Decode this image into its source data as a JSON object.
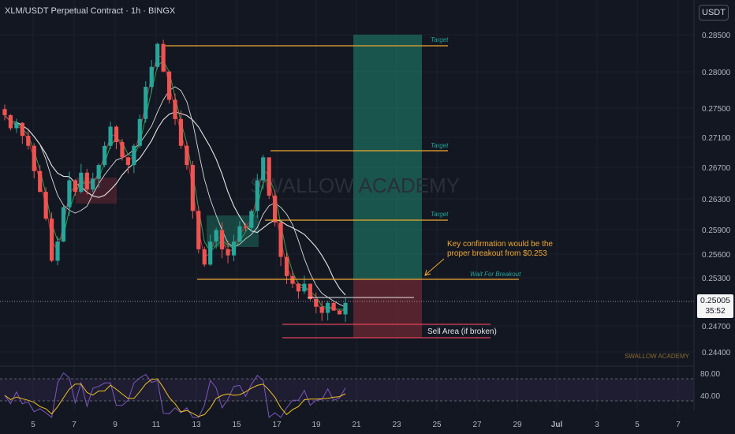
{
  "header": {
    "title": "XLM/USDT Perpetual Contract · 1h · BINGX",
    "currency_button": "USDT"
  },
  "watermark": "SWALLOW ACADEMY",
  "watermark_small": "SWALLOW ACADEMY",
  "last_price": {
    "value": "0.25005",
    "countdown": "35:52"
  },
  "colors": {
    "background": "#131722",
    "up": "#26a69a",
    "down": "#ef5350",
    "level_line": "#f0a830",
    "target_zone": "#1e7f6b",
    "stop_zone": "#7a2a36",
    "sell_line": "#e0435a",
    "rsi_line": "#7e57c2",
    "rsi_signal": "#f0c020"
  },
  "annotations": {
    "target_1": "Target",
    "target_2": "Target",
    "target_3": "Target",
    "wait": "Wait For Breakout",
    "note_line1": "Key confirmation would be the",
    "note_line2": "proper breakout from $0.253",
    "sell": "Sell Area (if broken)"
  },
  "chart_data": {
    "type": "candlestick",
    "y_ticks": [
      "0.28500",
      "0.28000",
      "0.27500",
      "0.27100",
      "0.26700",
      "0.26300",
      "0.25900",
      "0.25600",
      "0.25300",
      "0.24700",
      "0.24400"
    ],
    "x_ticks": [
      "5",
      "7",
      "9",
      "11",
      "13",
      "15",
      "17",
      "19",
      "21",
      "23",
      "25",
      "27",
      "29",
      "Jul",
      "3",
      "5",
      "7"
    ],
    "ylim": [
      0.2425,
      0.2872
    ],
    "levels": [
      {
        "name": "Target",
        "price": 0.284
      },
      {
        "name": "Target",
        "price": 0.269
      },
      {
        "name": "Target",
        "price": 0.2601
      },
      {
        "name": "Wait For Breakout",
        "price": 0.2529
      },
      {
        "name": "Sell Area (if broken)",
        "price": 0.2472
      }
    ],
    "closes": [
      0.2745,
      0.2728,
      0.2735,
      0.2718,
      0.2705,
      0.2672,
      0.2645,
      0.261,
      0.2555,
      0.258,
      0.2625,
      0.266,
      0.2645,
      0.267,
      0.2648,
      0.2662,
      0.268,
      0.2705,
      0.273,
      0.271,
      0.269,
      0.268,
      0.2705,
      0.274,
      0.2782,
      0.2808,
      0.2838,
      0.2802,
      0.2765,
      0.274,
      0.2705,
      0.268,
      0.262,
      0.257,
      0.255,
      0.258,
      0.2595,
      0.257,
      0.2562,
      0.258,
      0.26,
      0.2598,
      0.262,
      0.266,
      0.269,
      0.264,
      0.2605,
      0.256,
      0.2535,
      0.2525,
      0.2515,
      0.2525,
      0.2505,
      0.2495,
      0.2487,
      0.25,
      0.249,
      0.2485,
      0.25
    ],
    "rsi": {
      "levels": [
        80.0,
        40.0
      ],
      "y_ticks": [
        "80.00",
        "40.00"
      ]
    }
  }
}
